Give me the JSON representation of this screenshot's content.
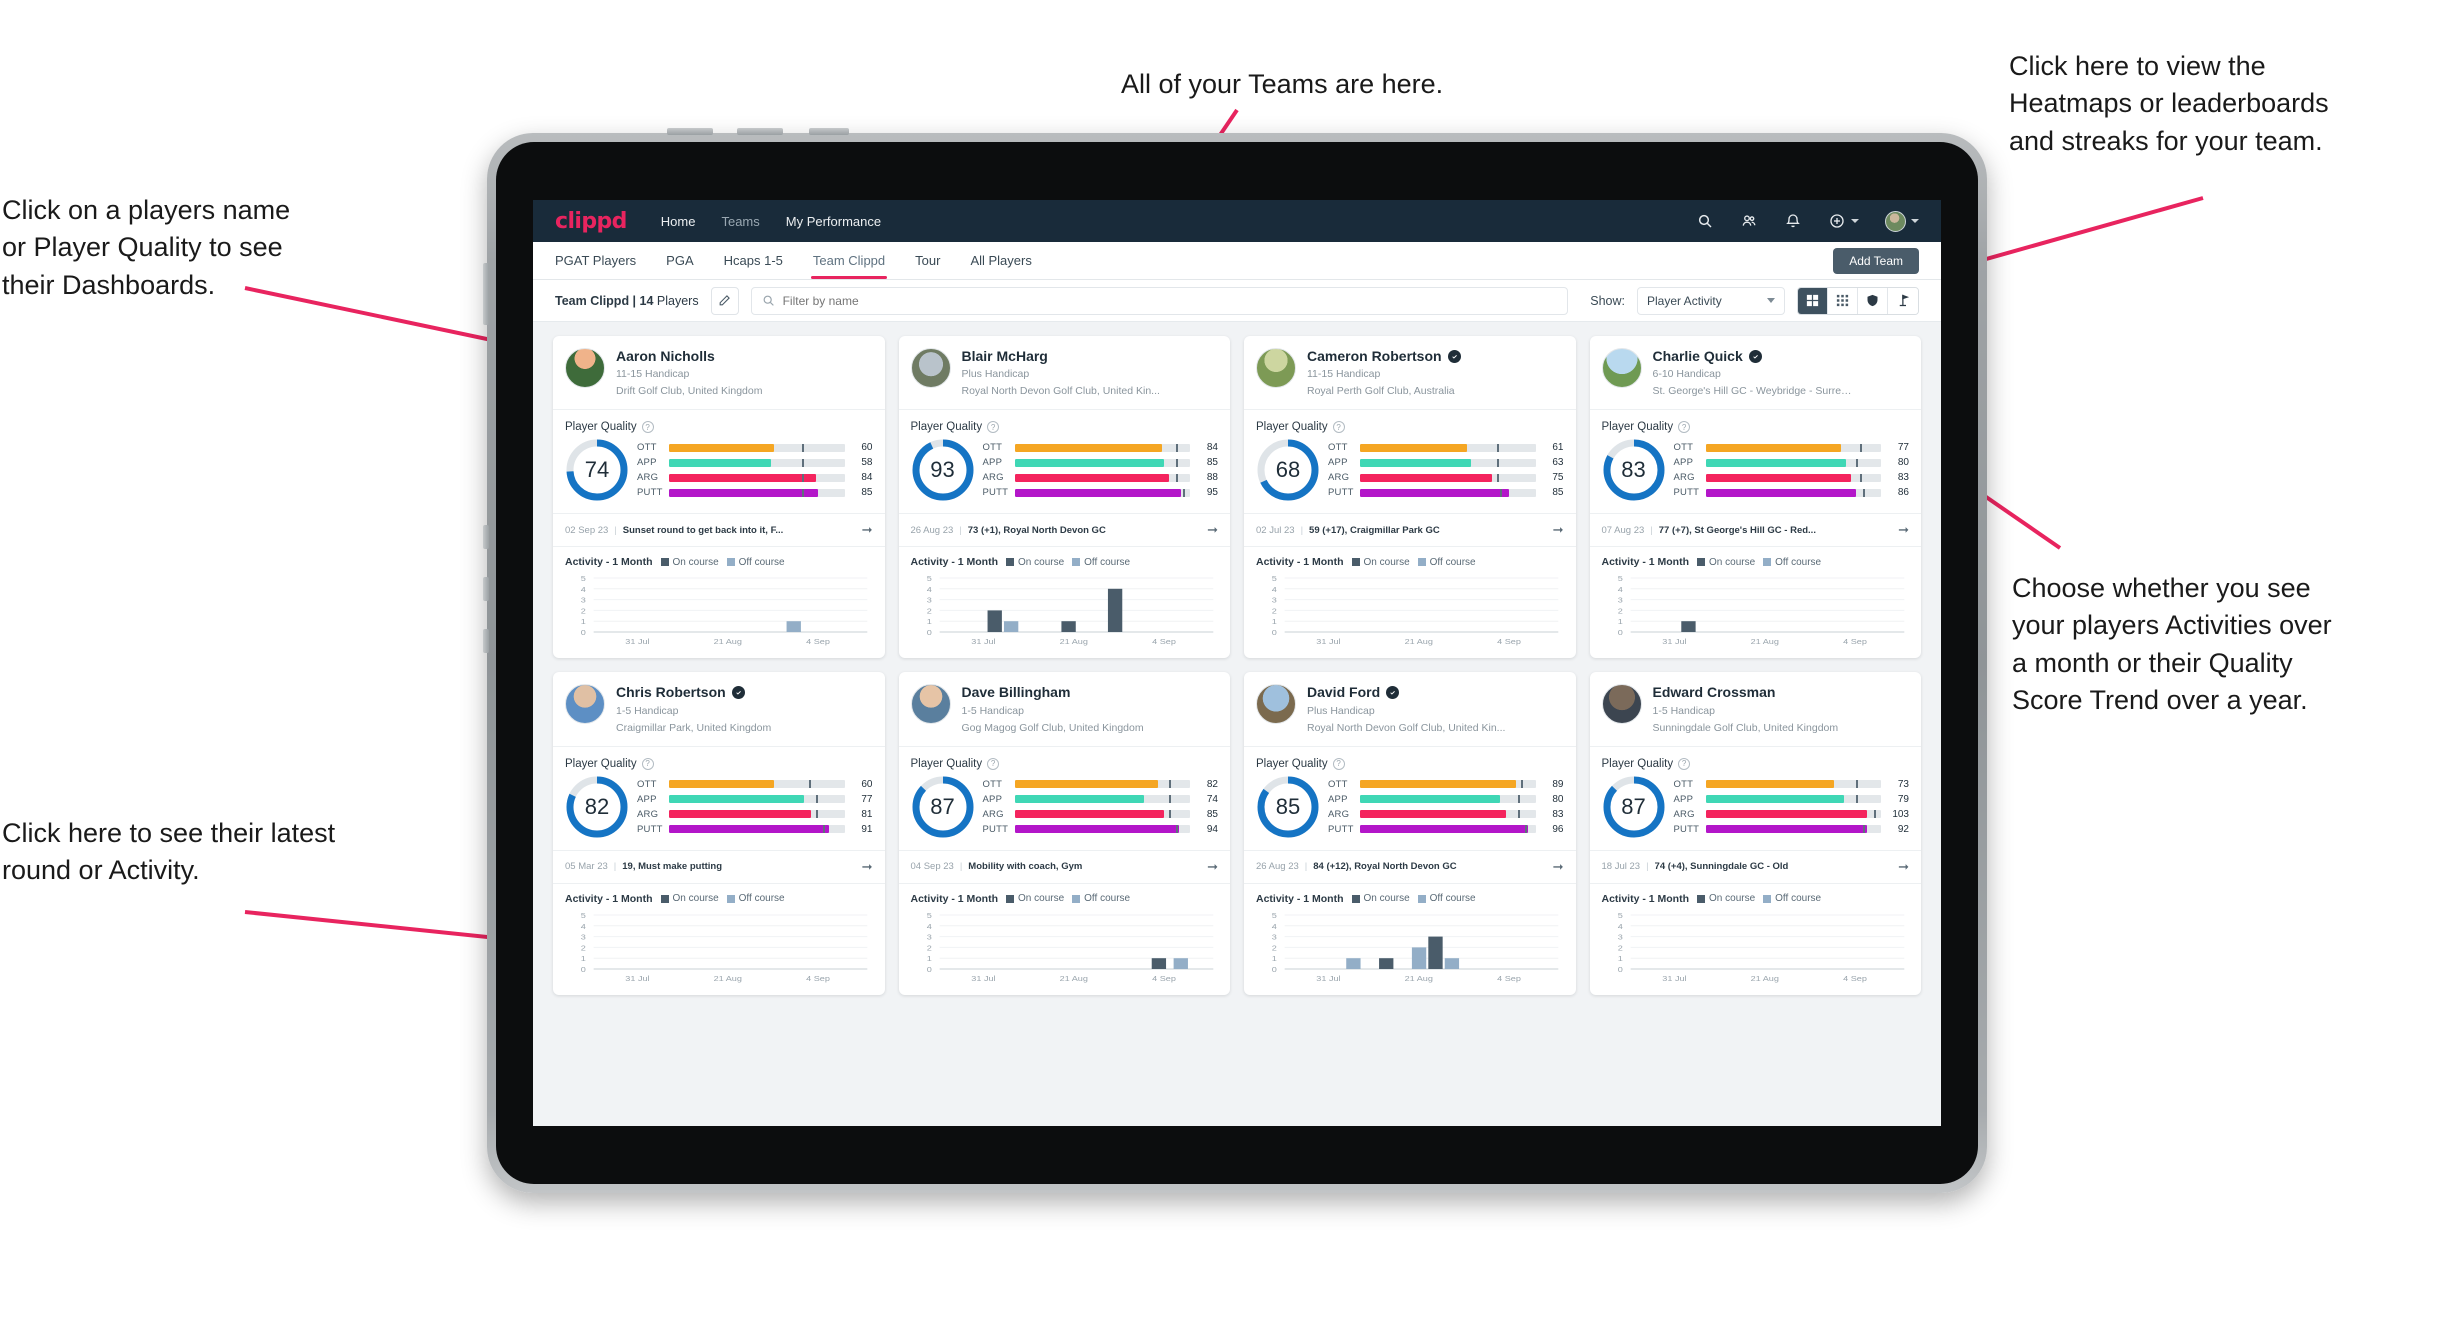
{
  "annotations": [
    {
      "id": "teams",
      "text": "All of your Teams are here."
    },
    {
      "id": "heatmaps",
      "text": "Click here to view the\nHeatmaps or leaderboards\nand streaks for your team."
    },
    {
      "id": "playernames",
      "text": "Click on a players name\nor Player Quality to see\ntheir Dashboards."
    },
    {
      "id": "activity-choice",
      "text": "Choose whether you see\nyour players Activities over\na month or their Quality\nScore Trend over a year."
    },
    {
      "id": "latest-round",
      "text": "Click here to see their latest\nround or Activity."
    }
  ],
  "app": {
    "brand": "clippd",
    "nav_links": [
      {
        "label": "Home",
        "active": true
      },
      {
        "label": "Teams",
        "active": false
      },
      {
        "label": "My Performance",
        "active": true
      }
    ],
    "nav_icons": [
      "search-icon",
      "people-icon",
      "bell-icon",
      "plus-circle-icon",
      "avatar"
    ],
    "tabs": [
      {
        "label": "PGAT Players",
        "active": false
      },
      {
        "label": "PGA",
        "active": false
      },
      {
        "label": "Hcaps 1-5",
        "active": false
      },
      {
        "label": "Team Clippd",
        "active": true
      },
      {
        "label": "Tour",
        "active": false
      },
      {
        "label": "All Players",
        "active": false
      }
    ],
    "add_team_label": "Add Team",
    "filter": {
      "team_label_bold": "Team Clippd | 14",
      "team_label_rest": " Players",
      "edit_icon": "pencil-icon",
      "search_placeholder": "Filter by name",
      "show_label": "Show:",
      "select_value": "Player Activity",
      "view_buttons": [
        "grid-large-icon",
        "grid-small-icon",
        "shield-icon",
        "flag-icon"
      ]
    },
    "colors": {
      "brand_pink": "#e8245f",
      "nav_bg": "#192b3a",
      "ring_blue": "#1574c4",
      "ott": "#f5a623",
      "app": "#3fd7b5",
      "arg": "#f4245e",
      "putt": "#b316c9",
      "on_course": "#4a5c6a",
      "off_course": "#93aec7"
    }
  },
  "players": [
    {
      "name": "Aaron Nicholls",
      "verified": false,
      "handicap": "11-15 Handicap",
      "club": "Drift Golf Club, United Kingdom",
      "quality": 74,
      "metrics": [
        {
          "key": "OTT",
          "value": 60,
          "pct": 60,
          "tick": 76
        },
        {
          "key": "APP",
          "value": 58,
          "pct": 58,
          "tick": 76
        },
        {
          "key": "ARG",
          "value": 84,
          "pct": 84,
          "tick": 76
        },
        {
          "key": "PUTT",
          "value": 85,
          "pct": 85,
          "tick": 76
        }
      ],
      "latest": {
        "date": "02 Sep 23",
        "text": "Sunset round to get back into it, F..."
      },
      "activity": {
        "title": "Activity - 1 Month",
        "legend": [
          "On course",
          "Off course"
        ],
        "ymax": 5,
        "yticks": [
          5,
          4,
          3,
          2,
          1,
          0
        ],
        "xticks": [
          "31 Jul",
          "21 Aug",
          "4 Sep"
        ],
        "bars": [
          {
            "x": 0.705,
            "h": 1,
            "type": "off"
          }
        ]
      }
    },
    {
      "name": "Blair McHarg",
      "verified": false,
      "handicap": "Plus Handicap",
      "club": "Royal North Devon Golf Club, United Kin...",
      "quality": 93,
      "metrics": [
        {
          "key": "OTT",
          "value": 84,
          "pct": 84,
          "tick": 92
        },
        {
          "key": "APP",
          "value": 85,
          "pct": 85,
          "tick": 92
        },
        {
          "key": "ARG",
          "value": 88,
          "pct": 88,
          "tick": 92
        },
        {
          "key": "PUTT",
          "value": 95,
          "pct": 95,
          "tick": 96
        }
      ],
      "latest": {
        "date": "26 Aug 23",
        "text": "73 (+1), Royal North Devon GC"
      },
      "activity": {
        "title": "Activity - 1 Month",
        "legend": [
          "On course",
          "Off course"
        ],
        "ymax": 5,
        "yticks": [
          5,
          4,
          3,
          2,
          1,
          0
        ],
        "xticks": [
          "31 Jul",
          "21 Aug",
          "4 Sep"
        ],
        "bars": [
          {
            "x": 0.175,
            "h": 2,
            "type": "on"
          },
          {
            "x": 0.235,
            "h": 1,
            "type": "off"
          },
          {
            "x": 0.445,
            "h": 1,
            "type": "on"
          },
          {
            "x": 0.615,
            "h": 4,
            "type": "on"
          }
        ]
      }
    },
    {
      "name": "Cameron Robertson",
      "verified": true,
      "handicap": "11-15 Handicap",
      "club": "Royal Perth Golf Club, Australia",
      "quality": 68,
      "metrics": [
        {
          "key": "OTT",
          "value": 61,
          "pct": 61,
          "tick": 78
        },
        {
          "key": "APP",
          "value": 63,
          "pct": 63,
          "tick": 78
        },
        {
          "key": "ARG",
          "value": 75,
          "pct": 75,
          "tick": 78
        },
        {
          "key": "PUTT",
          "value": 85,
          "pct": 85,
          "tick": 80
        }
      ],
      "latest": {
        "date": "02 Jul 23",
        "text": "59 (+17), Craigmillar Park GC"
      },
      "activity": {
        "title": "Activity - 1 Month",
        "legend": [
          "On course",
          "Off course"
        ],
        "ymax": 5,
        "yticks": [
          5,
          4,
          3,
          2,
          1,
          0
        ],
        "xticks": [
          "31 Jul",
          "21 Aug",
          "4 Sep"
        ],
        "bars": []
      }
    },
    {
      "name": "Charlie Quick",
      "verified": true,
      "handicap": "6-10 Handicap",
      "club": "St. George's Hill GC - Weybridge - Surrey, ...",
      "quality": 83,
      "metrics": [
        {
          "key": "OTT",
          "value": 77,
          "pct": 77,
          "tick": 88
        },
        {
          "key": "APP",
          "value": 80,
          "pct": 80,
          "tick": 86
        },
        {
          "key": "ARG",
          "value": 83,
          "pct": 83,
          "tick": 88
        },
        {
          "key": "PUTT",
          "value": 86,
          "pct": 86,
          "tick": 90
        }
      ],
      "latest": {
        "date": "07 Aug 23",
        "text": "77 (+7), St George's Hill GC - Red..."
      },
      "activity": {
        "title": "Activity - 1 Month",
        "legend": [
          "On course",
          "Off course"
        ],
        "ymax": 5,
        "yticks": [
          5,
          4,
          3,
          2,
          1,
          0
        ],
        "xticks": [
          "31 Jul",
          "21 Aug",
          "4 Sep"
        ],
        "bars": [
          {
            "x": 0.185,
            "h": 1,
            "type": "on"
          }
        ]
      }
    },
    {
      "name": "Chris Robertson",
      "verified": true,
      "handicap": "1-5 Handicap",
      "club": "Craigmillar Park, United Kingdom",
      "quality": 82,
      "metrics": [
        {
          "key": "OTT",
          "value": 60,
          "pct": 60,
          "tick": 80
        },
        {
          "key": "APP",
          "value": 77,
          "pct": 77,
          "tick": 84
        },
        {
          "key": "ARG",
          "value": 81,
          "pct": 81,
          "tick": 84
        },
        {
          "key": "PUTT",
          "value": 91,
          "pct": 91,
          "tick": 88
        }
      ],
      "latest": {
        "date": "05 Mar 23",
        "text": "19, Must make putting"
      },
      "activity": {
        "title": "Activity - 1 Month",
        "legend": [
          "On course",
          "Off course"
        ],
        "ymax": 5,
        "yticks": [
          5,
          4,
          3,
          2,
          1,
          0
        ],
        "xticks": [
          "31 Jul",
          "21 Aug",
          "4 Sep"
        ],
        "bars": []
      }
    },
    {
      "name": "Dave Billingham",
      "verified": false,
      "handicap": "1-5 Handicap",
      "club": "Gog Magog Golf Club, United Kingdom",
      "quality": 87,
      "metrics": [
        {
          "key": "OTT",
          "value": 82,
          "pct": 82,
          "tick": 88
        },
        {
          "key": "APP",
          "value": 74,
          "pct": 74,
          "tick": 88
        },
        {
          "key": "ARG",
          "value": 85,
          "pct": 85,
          "tick": 88
        },
        {
          "key": "PUTT",
          "value": 94,
          "pct": 94,
          "tick": 92
        }
      ],
      "latest": {
        "date": "04 Sep 23",
        "text": "Mobility with coach, Gym"
      },
      "activity": {
        "title": "Activity - 1 Month",
        "legend": [
          "On course",
          "Off course"
        ],
        "ymax": 5,
        "yticks": [
          5,
          4,
          3,
          2,
          1,
          0
        ],
        "xticks": [
          "31 Jul",
          "21 Aug",
          "4 Sep"
        ],
        "bars": [
          {
            "x": 0.775,
            "h": 1,
            "type": "on"
          },
          {
            "x": 0.855,
            "h": 1,
            "type": "off"
          }
        ]
      }
    },
    {
      "name": "David Ford",
      "verified": true,
      "handicap": "Plus Handicap",
      "club": "Royal North Devon Golf Club, United Kin...",
      "quality": 85,
      "metrics": [
        {
          "key": "OTT",
          "value": 89,
          "pct": 89,
          "tick": 92
        },
        {
          "key": "APP",
          "value": 80,
          "pct": 80,
          "tick": 90
        },
        {
          "key": "ARG",
          "value": 83,
          "pct": 83,
          "tick": 90
        },
        {
          "key": "PUTT",
          "value": 96,
          "pct": 96,
          "tick": 94
        }
      ],
      "latest": {
        "date": "26 Aug 23",
        "text": "84 (+12), Royal North Devon GC"
      },
      "activity": {
        "title": "Activity - 1 Month",
        "legend": [
          "On course",
          "Off course"
        ],
        "ymax": 5,
        "yticks": [
          5,
          4,
          3,
          2,
          1,
          0
        ],
        "xticks": [
          "31 Jul",
          "21 Aug",
          "4 Sep"
        ],
        "bars": [
          {
            "x": 0.225,
            "h": 1,
            "type": "off"
          },
          {
            "x": 0.345,
            "h": 1,
            "type": "on"
          },
          {
            "x": 0.465,
            "h": 2,
            "type": "off"
          },
          {
            "x": 0.525,
            "h": 3,
            "type": "on"
          },
          {
            "x": 0.585,
            "h": 1,
            "type": "off"
          }
        ]
      }
    },
    {
      "name": "Edward Crossman",
      "verified": false,
      "handicap": "1-5 Handicap",
      "club": "Sunningdale Golf Club, United Kingdom",
      "quality": 87,
      "metrics": [
        {
          "key": "OTT",
          "value": 73,
          "pct": 73,
          "tick": 86
        },
        {
          "key": "APP",
          "value": 79,
          "pct": 79,
          "tick": 86
        },
        {
          "key": "ARG",
          "value": 103,
          "pct": 92,
          "tick": 96
        },
        {
          "key": "PUTT",
          "value": 92,
          "pct": 92,
          "tick": 90
        }
      ],
      "latest": {
        "date": "18 Jul 23",
        "text": "74 (+4), Sunningdale GC - Old"
      },
      "activity": {
        "title": "Activity - 1 Month",
        "legend": [
          "On course",
          "Off course"
        ],
        "ymax": 5,
        "yticks": [
          5,
          4,
          3,
          2,
          1,
          0
        ],
        "xticks": [
          "31 Jul",
          "21 Aug",
          "4 Sep"
        ],
        "bars": []
      }
    }
  ]
}
